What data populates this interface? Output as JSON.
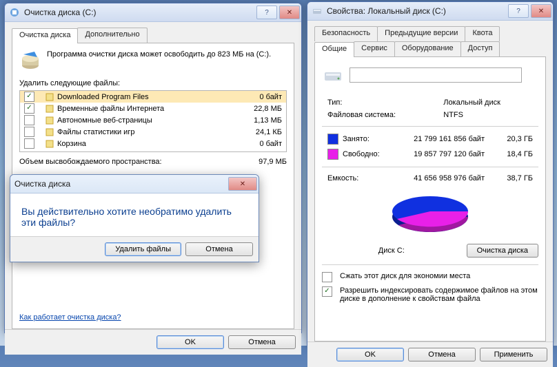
{
  "cleanup": {
    "title": "Очистка диска  (C:)",
    "tabs": {
      "main": "Очистка диска",
      "extra": "Дополнительно"
    },
    "desc": "Программа очистки диска может освободить до 823 МБ на  (C:).",
    "delete_label": "Удалить следующие файлы:",
    "items": [
      {
        "checked": true,
        "name": "Downloaded Program Files",
        "size": "0 байт",
        "sel": true
      },
      {
        "checked": true,
        "name": "Временные файлы Интернета",
        "size": "22,8 МБ"
      },
      {
        "checked": false,
        "name": "Автономные веб-страницы",
        "size": "1,13 МБ"
      },
      {
        "checked": false,
        "name": "Файлы статистики игр",
        "size": "24,1 КБ"
      },
      {
        "checked": false,
        "name": "Корзина",
        "size": "0 байт"
      }
    ],
    "freed_label": "Объем высвобождаемого пространства:",
    "freed_value": "97,9 МБ",
    "help_link": "Как работает очистка диска?",
    "ok": "OK",
    "cancel": "Отмена"
  },
  "confirm": {
    "title": "Очистка диска",
    "message": "Вы действительно хотите необратимо удалить эти файлы?",
    "yes": "Удалить файлы",
    "no": "Отмена"
  },
  "props": {
    "title": "Свойства: Локальный диск (C:)",
    "tabs": {
      "security": "Безопасность",
      "prev": "Предыдущие версии",
      "quota": "Квота",
      "general": "Общие",
      "service": "Сервис",
      "hardware": "Оборудование",
      "access": "Доступ"
    },
    "type_lbl": "Тип:",
    "type_val": "Локальный диск",
    "fs_lbl": "Файловая система:",
    "fs_val": "NTFS",
    "used_lbl": "Занято:",
    "used_bytes": "21 799 161 856 байт",
    "used_gb": "20,3 ГБ",
    "free_lbl": "Свободно:",
    "free_bytes": "19 857 797 120 байт",
    "free_gb": "18,4 ГБ",
    "cap_lbl": "Емкость:",
    "cap_bytes": "41 656 958 976 байт",
    "cap_gb": "38,7 ГБ",
    "drive_label": "Диск C:",
    "cleanup_btn": "Очистка диска",
    "compress": "Сжать этот диск для экономии места",
    "index": "Разрешить индексировать содержимое файлов на этом диске в дополнение к свойствам файла",
    "ok": "OK",
    "cancel": "Отмена",
    "apply": "Применить"
  },
  "chart_data": {
    "type": "pie",
    "title": "Диск C:",
    "series": [
      {
        "name": "Занято",
        "value_bytes": 21799161856,
        "value_gb": 20.3,
        "color": "#1030e0"
      },
      {
        "name": "Свободно",
        "value_bytes": 19857797120,
        "value_gb": 18.4,
        "color": "#e820e8"
      }
    ],
    "total_bytes": 41656958976,
    "total_gb": 38.7
  }
}
